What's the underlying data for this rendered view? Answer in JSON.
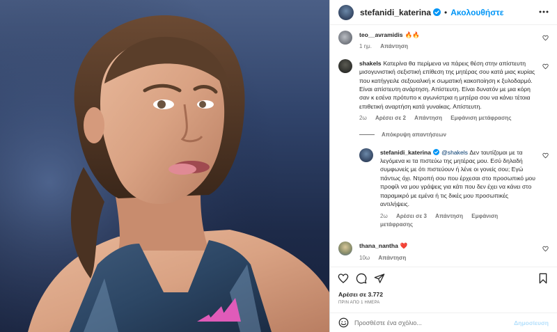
{
  "header": {
    "username": "stefanidi_katerina",
    "follow_label": "Ακολουθήστε",
    "verified_icon": "verified-badge-icon",
    "more_icon": "more-options-icon"
  },
  "comments": [
    {
      "username": "teo__avramidis",
      "text": "🔥🔥",
      "time": "1 ημ.",
      "reply_label": "Απάντηση"
    },
    {
      "username": "shakels",
      "text": "Κατερίνα θα περίμενα να πάρεις θέση στην απίστευτη μισογυνιστική σεξιστική επίθεση της μητέρας σου κατά μιας κυρίας που κατήγγειλε σεξουαλική κ σωματική κακοποίηση κ ξυλοδαρμό. Είναι απίστευτη ανάρτηση. Απίστευτη. Είναι δυνατόν με μια κόρη σαν κ εσένα πρότυπο κ αγωνίστρια η μητέρα σου να κάνει τέτοια επιθετική αναρτήση κατά γυναίκας. Απίστευτη.",
      "time": "2ω",
      "likes": "Αρέσει σε 2",
      "reply_label": "Απάντηση",
      "translate_label": "Εμφάνιση μετάφρασης",
      "hide_replies": "Απόκρυψη απαντήσεων",
      "reply": {
        "username": "stefanidi_katerina",
        "mention": "@shakels",
        "text": "Δεν ταυτίζομαι με τα λεγόμενα κι τα πιστεύω της μητέρας μου. Εσύ δηλαδή συμφωνείς με ότι πιστεύουν ή λένε οι γονείς σου; Εγώ πάντως όχι. Ντροπή σου που έρχεσαι στο προσωπικό μου προφίλ να μου γράψεις για κάτι που δεν έχει να κάνει στο παραμικρό με εμένα ή τις δικές μου προσωπικές αντιλήψεις.",
        "time": "2ω",
        "likes": "Αρέσει σε 3",
        "reply_label": "Απάντηση",
        "translate_label": "Εμφάνιση μετάφρασης"
      }
    },
    {
      "username": "thana_nantha",
      "text": "❤️",
      "time": "10ω",
      "reply_label": "Απάντηση"
    }
  ],
  "actions": {
    "like_icon": "heart-icon",
    "comment_icon": "comment-icon",
    "share_icon": "share-icon",
    "save_icon": "bookmark-icon"
  },
  "likes_label": "Αρέσει σε 3.772",
  "date_label": "ΠΡΙΝ ΑΠΟ 1 ΗΜΕΡΑ",
  "add_comment": {
    "placeholder": "Προσθέστε ένα σχόλιο...",
    "post_label": "Δημοσίευση",
    "emoji_icon": "emoji-icon"
  },
  "colors": {
    "accent": "#0095f6",
    "mention": "#00376b",
    "secondary_text": "#737373",
    "post_disabled": "#b2dffc"
  }
}
